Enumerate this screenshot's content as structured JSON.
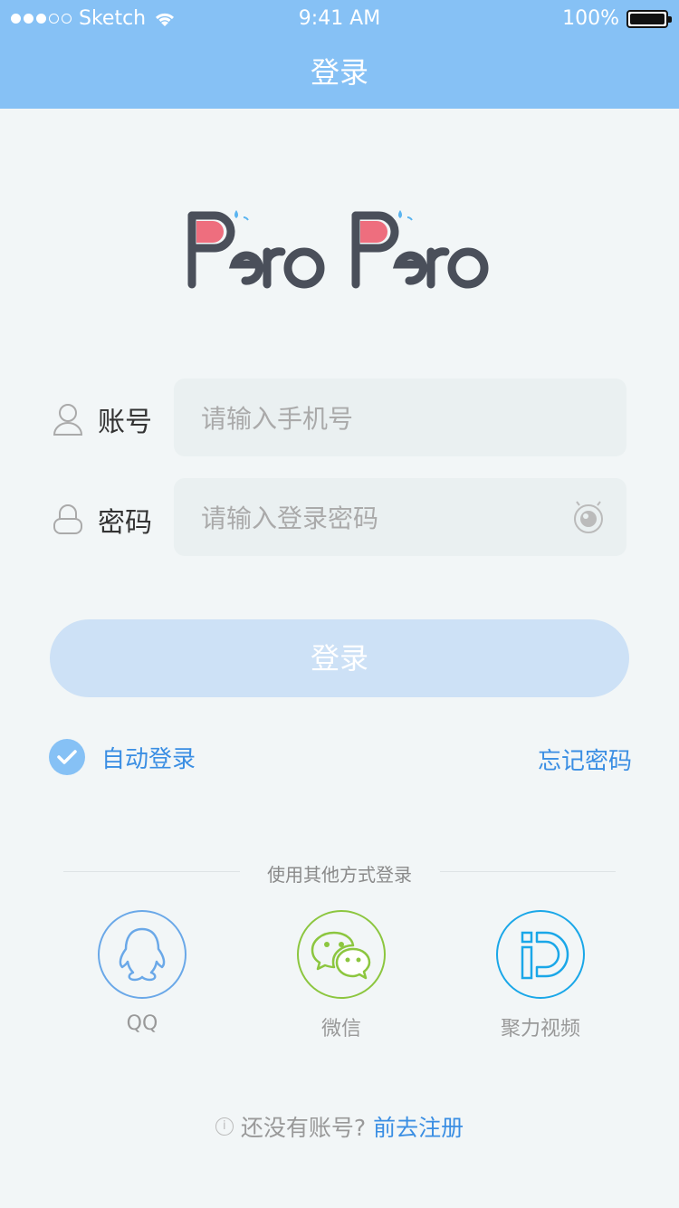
{
  "status_bar": {
    "carrier": "Sketch",
    "time": "9:41 AM",
    "battery": "100%"
  },
  "nav": {
    "title": "登录"
  },
  "logo": {
    "text": "PeroPero"
  },
  "form": {
    "account_label": "账号",
    "account_placeholder": "请输入手机号",
    "password_label": "密码",
    "password_placeholder": "请输入登录密码"
  },
  "login_button": "登录",
  "options": {
    "auto_login": "自动登录",
    "auto_login_checked": true,
    "forgot_password": "忘记密码"
  },
  "other_login": {
    "title": "使用其他方式登录",
    "providers": [
      {
        "label": "QQ",
        "icon": "qq-icon",
        "color": "#6aa8e8"
      },
      {
        "label": "微信",
        "icon": "wechat-icon",
        "color": "#8cc63f"
      },
      {
        "label": "聚力视频",
        "icon": "pptv-icon",
        "color": "#1aa7e8"
      }
    ]
  },
  "register": {
    "prompt": "还没有账号?",
    "link": "前去注册"
  },
  "colors": {
    "primary": "#86c1f5",
    "link": "#3a8ee3",
    "background": "#f2f6f7"
  }
}
